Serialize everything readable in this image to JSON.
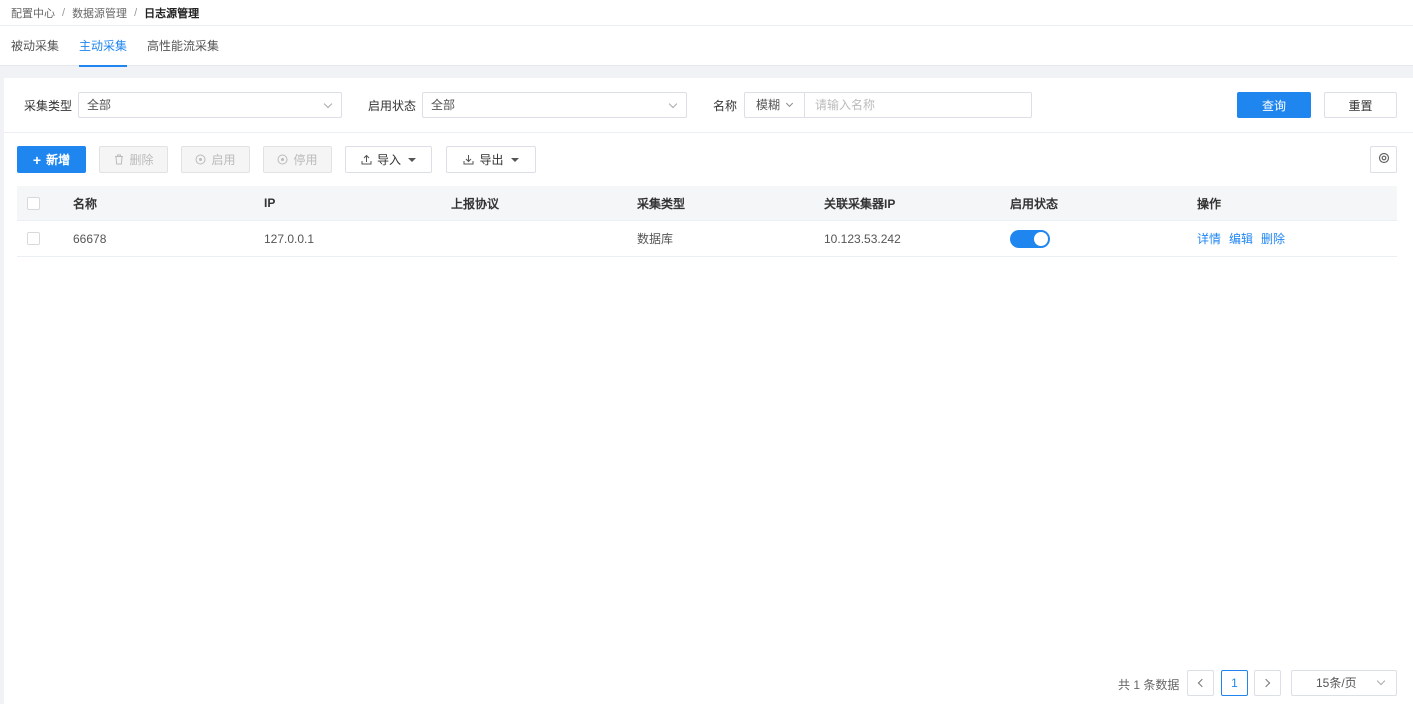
{
  "breadcrumb": {
    "items": [
      "配置中心",
      "数据源管理",
      "日志源管理"
    ],
    "separator": "/"
  },
  "tabs": [
    {
      "label": "被动采集",
      "active": false
    },
    {
      "label": "主动采集",
      "active": true
    },
    {
      "label": "高性能流采集",
      "active": false
    }
  ],
  "filters": {
    "collect_type": {
      "label": "采集类型",
      "value": "全部"
    },
    "enable_status": {
      "label": "启用状态",
      "value": "全部"
    },
    "name": {
      "label": "名称",
      "mode": "模糊",
      "placeholder": "请输入名称",
      "value": ""
    },
    "query_label": "查询",
    "reset_label": "重置"
  },
  "toolbar": {
    "add_label": "新增",
    "delete_label": "删除",
    "enable_label": "启用",
    "disable_label": "停用",
    "import_label": "导入",
    "export_label": "导出"
  },
  "table": {
    "columns": [
      "名称",
      "IP",
      "上报协议",
      "采集类型",
      "关联采集器IP",
      "启用状态",
      "操作"
    ],
    "rows": [
      {
        "name": "66678",
        "ip": "127.0.0.1",
        "protocol": "",
        "collect_type": "数据库",
        "collector_ip": "10.123.53.242",
        "enabled": true,
        "actions": [
          "详情",
          "编辑",
          "删除"
        ]
      }
    ]
  },
  "pagination": {
    "total_text": "共 1 条数据",
    "current_page": "1",
    "page_size": "15条/页"
  },
  "colors": {
    "accent": "#1f86f0"
  }
}
